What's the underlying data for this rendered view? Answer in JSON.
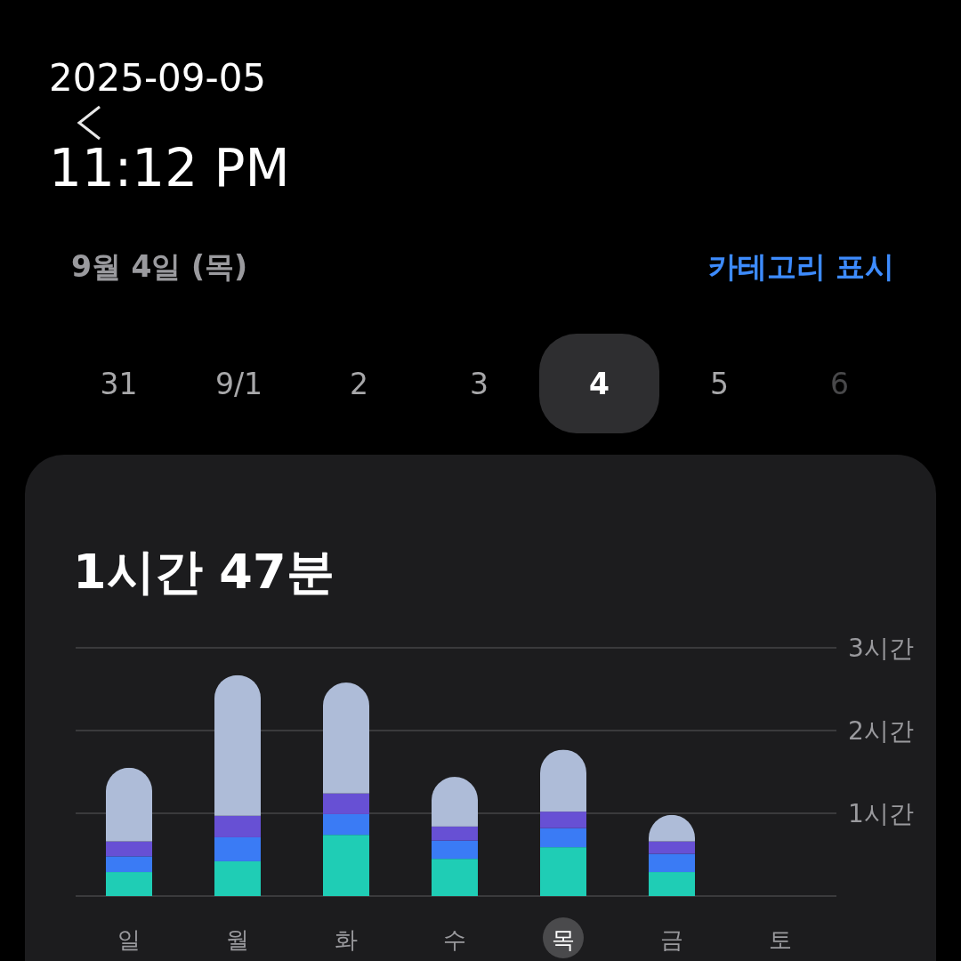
{
  "timestamp": {
    "date": "2025-09-05",
    "time": "11:12 PM"
  },
  "header": {
    "date_label": "9월 4일 (목)",
    "action": "카테고리 표시"
  },
  "day_picker": [
    {
      "label": "31",
      "selected": false,
      "disabled": false
    },
    {
      "label": "9/1",
      "selected": false,
      "disabled": false
    },
    {
      "label": "2",
      "selected": false,
      "disabled": false
    },
    {
      "label": "3",
      "selected": false,
      "disabled": false
    },
    {
      "label": "4",
      "selected": true,
      "disabled": false
    },
    {
      "label": "5",
      "selected": false,
      "disabled": false
    },
    {
      "label": "6",
      "selected": false,
      "disabled": true
    }
  ],
  "summary_card": {
    "total": "1시간 47분",
    "category_selected": [
      false,
      false,
      false,
      false,
      true,
      false,
      false
    ],
    "chart_data": {
      "type": "bar",
      "stacked": true,
      "categories": [
        "일",
        "월",
        "화",
        "수",
        "목",
        "금",
        "토"
      ],
      "ylim": [
        0,
        3
      ],
      "yticks": [
        {
          "value": 1,
          "label": "1시간"
        },
        {
          "value": 2,
          "label": "2시간"
        },
        {
          "value": 3,
          "label": "3시간"
        }
      ],
      "series": [
        {
          "color": "#1fcdb5",
          "values": [
            0.29,
            0.42,
            0.74,
            0.45,
            0.59,
            0.29,
            null
          ]
        },
        {
          "color": "#3a7bf5",
          "values": [
            0.19,
            0.29,
            0.25,
            0.22,
            0.23,
            0.22,
            null
          ]
        },
        {
          "color": "#6750d4",
          "values": [
            0.18,
            0.26,
            0.25,
            0.17,
            0.2,
            0.15,
            null
          ]
        },
        {
          "color": "#aebcd8",
          "values": [
            0.89,
            1.7,
            1.34,
            0.6,
            0.75,
            0.32,
            null
          ]
        }
      ]
    }
  }
}
